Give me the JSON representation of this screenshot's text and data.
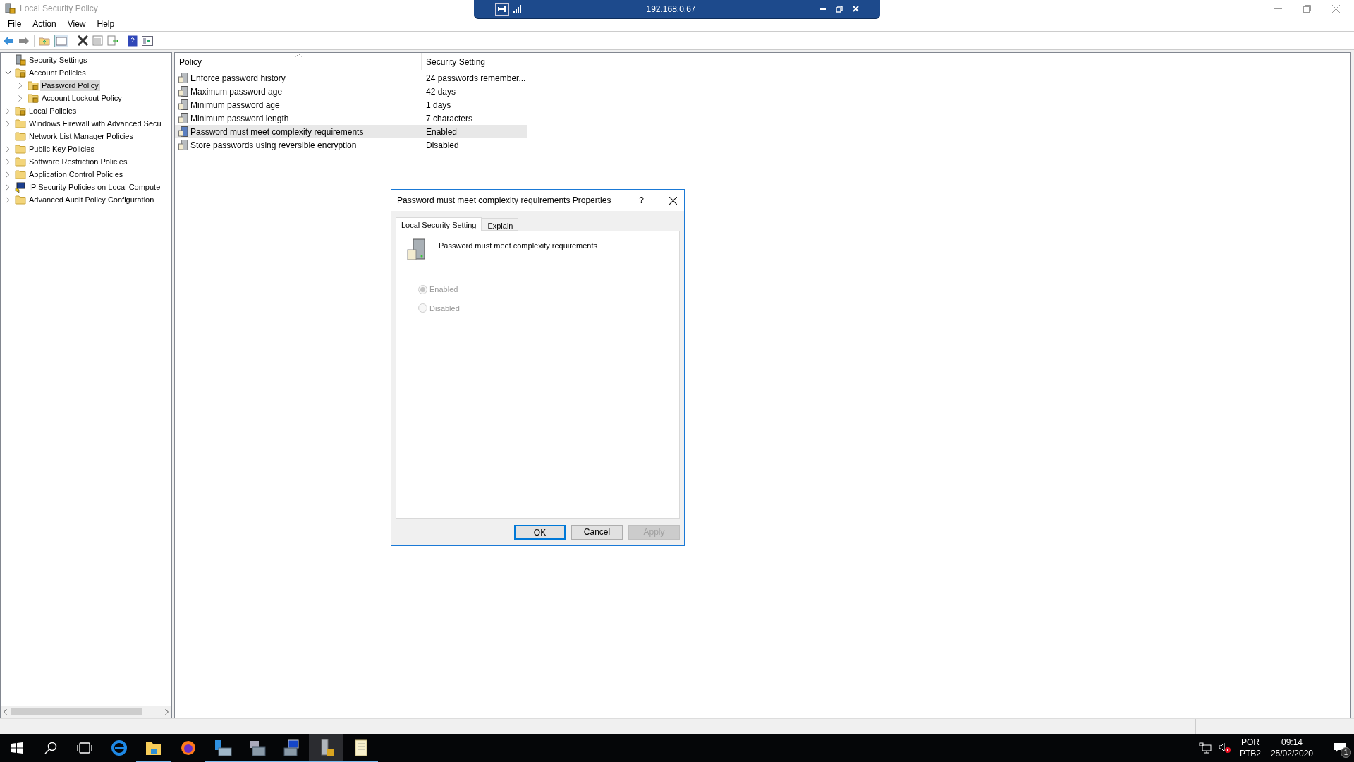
{
  "window": {
    "title": "Local Security Policy"
  },
  "menu": [
    "File",
    "Action",
    "View",
    "Help"
  ],
  "tree": [
    {
      "label": "Security Settings",
      "kind": "root",
      "expandable": false,
      "expanded": false,
      "selected": false,
      "children": [
        {
          "label": "Account Policies",
          "kind": "locked-folder",
          "expandable": true,
          "expanded": true,
          "selected": false,
          "children": [
            {
              "label": "Password Policy",
              "kind": "locked-folder",
              "expandable": true,
              "expanded": false,
              "selected": true
            },
            {
              "label": "Account Lockout Policy",
              "kind": "locked-folder",
              "expandable": true,
              "expanded": false,
              "selected": false
            }
          ]
        },
        {
          "label": "Local Policies",
          "kind": "locked-folder",
          "expandable": true,
          "expanded": false,
          "selected": false
        },
        {
          "label": "Windows Firewall with Advanced Secu",
          "kind": "folder",
          "expandable": true,
          "expanded": false,
          "selected": false
        },
        {
          "label": "Network List Manager Policies",
          "kind": "folder",
          "expandable": false,
          "expanded": false,
          "selected": false
        },
        {
          "label": "Public Key Policies",
          "kind": "folder",
          "expandable": true,
          "expanded": false,
          "selected": false
        },
        {
          "label": "Software Restriction Policies",
          "kind": "folder",
          "expandable": true,
          "expanded": false,
          "selected": false
        },
        {
          "label": "Application Control Policies",
          "kind": "folder",
          "expandable": true,
          "expanded": false,
          "selected": false
        },
        {
          "label": "IP Security Policies on Local Compute",
          "kind": "network",
          "expandable": true,
          "expanded": false,
          "selected": false
        },
        {
          "label": "Advanced Audit Policy Configuration",
          "kind": "folder",
          "expandable": true,
          "expanded": false,
          "selected": false
        }
      ]
    }
  ],
  "table": {
    "columns": [
      "Policy",
      "Security Setting"
    ],
    "rows": [
      {
        "policy": "Enforce password history",
        "setting": "24 passwords remember...",
        "selected": false
      },
      {
        "policy": "Maximum password age",
        "setting": "42 days",
        "selected": false
      },
      {
        "policy": "Minimum password age",
        "setting": "1 days",
        "selected": false
      },
      {
        "policy": "Minimum password length",
        "setting": "7 characters",
        "selected": false
      },
      {
        "policy": "Password must meet complexity requirements",
        "setting": "Enabled",
        "selected": true
      },
      {
        "policy": "Store passwords using reversible encryption",
        "setting": "Disabled",
        "selected": false
      }
    ]
  },
  "dialog": {
    "title": "Password must meet complexity requirements Properties",
    "help": "?",
    "tabs": [
      {
        "label": "Local Security Setting",
        "selected": true
      },
      {
        "label": "Explain",
        "selected": false
      }
    ],
    "heading": "Password must meet complexity requirements",
    "options": [
      {
        "label": "Enabled",
        "selected": true,
        "disabled": true
      },
      {
        "label": "Disabled",
        "selected": false,
        "disabled": true
      }
    ],
    "buttons": [
      {
        "label": "OK",
        "default": true,
        "disabled": false
      },
      {
        "label": "Cancel",
        "default": false,
        "disabled": false
      },
      {
        "label": "Apply",
        "default": false,
        "disabled": true
      }
    ]
  },
  "remote_bar": {
    "host": "192.168.0.67"
  },
  "taskbar": {
    "apps": [
      {
        "kind": "browser-e",
        "running": false,
        "active": false
      },
      {
        "kind": "folder",
        "running": true,
        "active": false
      },
      {
        "kind": "firefox",
        "running": false,
        "active": false
      },
      {
        "kind": "server",
        "running": true,
        "active": false
      },
      {
        "kind": "tools",
        "running": true,
        "active": false
      },
      {
        "kind": "monitor",
        "running": true,
        "active": false
      },
      {
        "kind": "lock-server",
        "running": true,
        "active": true
      },
      {
        "kind": "notepad",
        "running": true,
        "active": false
      }
    ],
    "language": "POR",
    "layout": "PTB2",
    "time": "09:14",
    "date": "25/02/2020",
    "notifications": "1"
  }
}
